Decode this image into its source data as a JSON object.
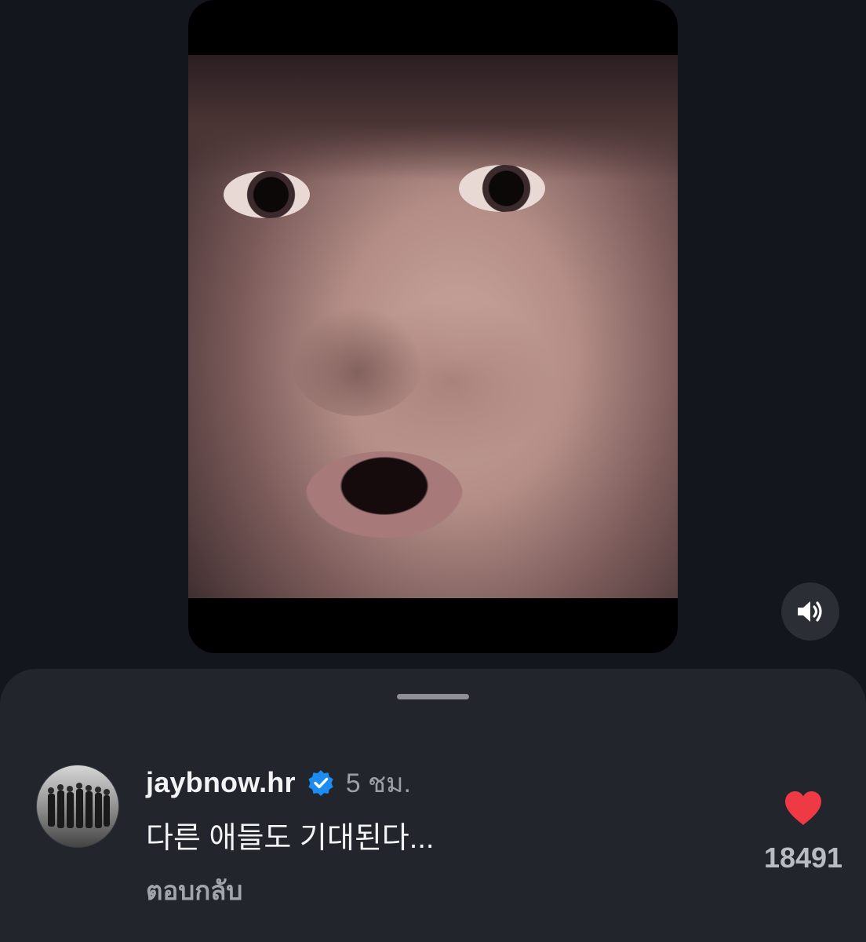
{
  "video": {
    "media_icon": "video-frame-face",
    "volume_icon": "speaker-on-icon"
  },
  "comment": {
    "username": "jaybnow.hr",
    "verified_icon": "verified-badge-icon",
    "time": "5 ชม.",
    "text": "다른 애들도 기대된다...",
    "reply_label": "ตอบกลับ",
    "like_icon": "heart-filled-icon",
    "like_count": "18491"
  },
  "colors": {
    "background": "#13161c",
    "sheet": "#22252b",
    "like_red": "#ef3a45",
    "verified_blue": "#1d8cf2"
  }
}
